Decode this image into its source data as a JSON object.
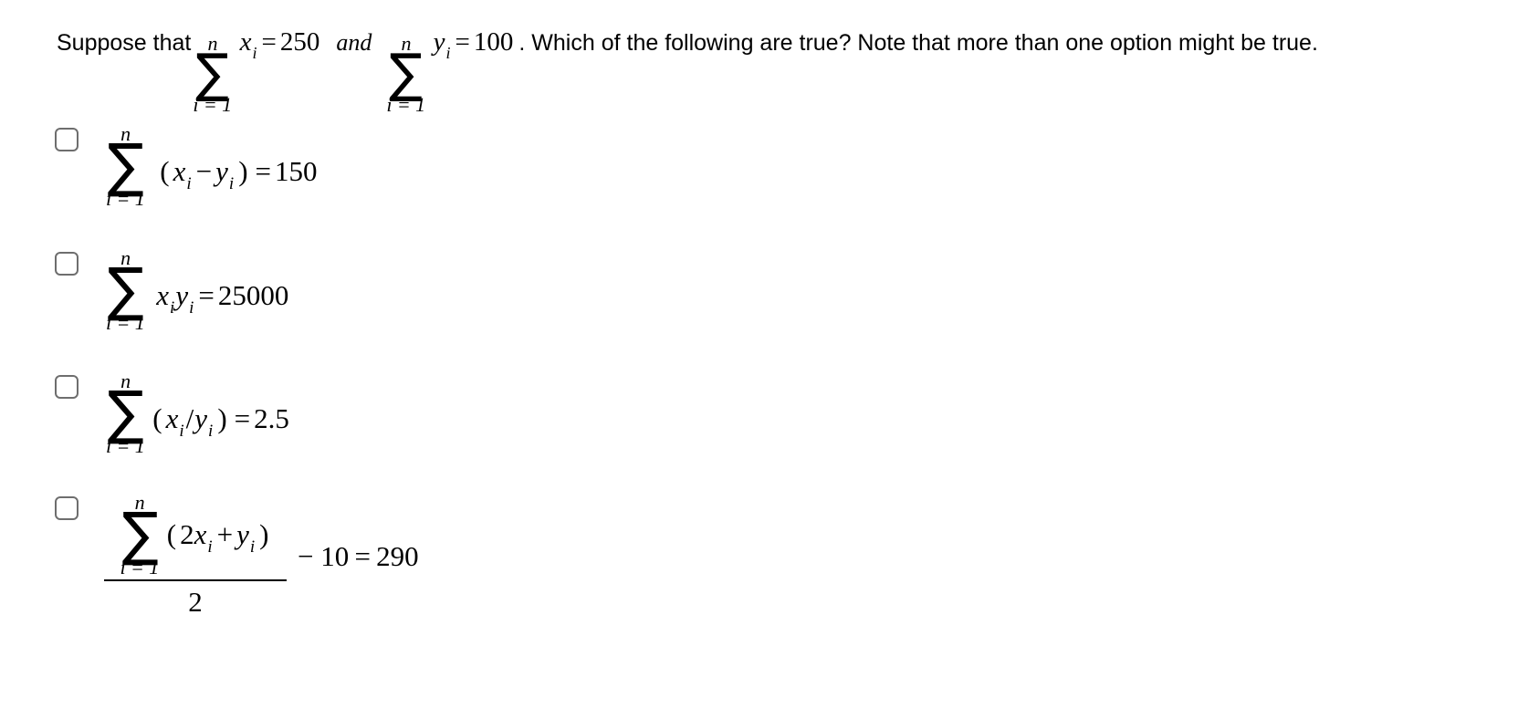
{
  "background_color": "#ffffff",
  "text_color": "#000000",
  "checkbox_border_color": "#6e6e6e",
  "question": {
    "lead_text": "Suppose that",
    "sum1": {
      "upper_limit": "n",
      "sigma": "∑",
      "lower_limit": "i = 1",
      "variable": "x",
      "subscript": "i",
      "equals": "=",
      "value": "250"
    },
    "conjunction": "and",
    "sum2": {
      "upper_limit": "n",
      "sigma": "∑",
      "lower_limit": "i = 1",
      "variable": "y",
      "subscript": "i",
      "equals": "=",
      "value": "100"
    },
    "tail_text": ". Which of the following are true? Note that more than one option might be true."
  },
  "options": [
    {
      "id": "option-1",
      "checked": false,
      "upper_limit": "n",
      "sigma": "∑",
      "lower_limit": "i = 1",
      "open_paren": "(",
      "var1": "x",
      "sub1": "i",
      "operator": "−",
      "var2": "y",
      "sub2": "i",
      "close_paren": ")",
      "equals": "=",
      "value": "150"
    },
    {
      "id": "option-2",
      "checked": false,
      "upper_limit": "n",
      "sigma": "∑",
      "lower_limit": "i = 1",
      "open_paren": "",
      "var1": "x",
      "sub1": "i",
      "operator": "",
      "var2": "y",
      "sub2": "i",
      "close_paren": "",
      "equals": "=",
      "value": "25000"
    },
    {
      "id": "option-3",
      "checked": false,
      "upper_limit": "n",
      "sigma": "∑",
      "lower_limit": "i = 1",
      "open_paren": "(",
      "var1": "x",
      "sub1": "i",
      "operator": "/",
      "var2": "y",
      "sub2": "i",
      "close_paren": ")",
      "equals": "=",
      "value": "2.5"
    },
    {
      "id": "option-4",
      "checked": false,
      "upper_limit": "n",
      "sigma": "∑",
      "lower_limit": "i = 1",
      "open_paren": "(",
      "coefficient": "2",
      "var1": "x",
      "sub1": "i",
      "operator": "+",
      "var2": "y",
      "sub2": "i",
      "close_paren": ")",
      "denominator": "2",
      "tail": "− 10 = 290"
    }
  ]
}
